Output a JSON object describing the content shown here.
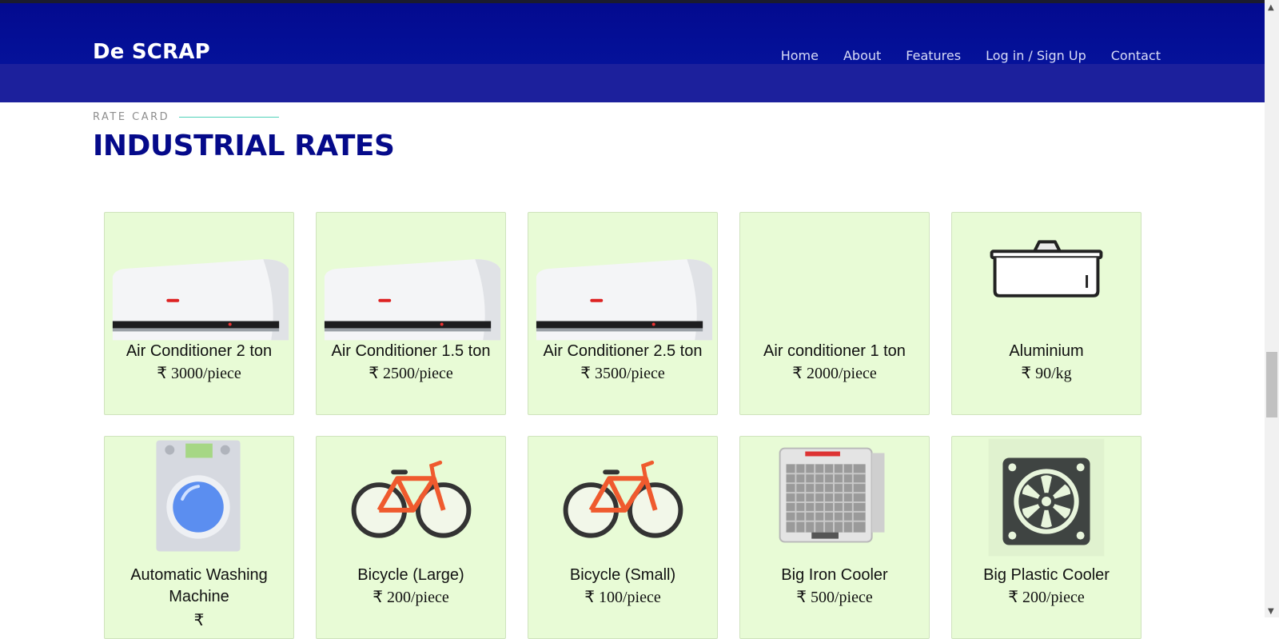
{
  "brand": "De SCRAP",
  "nav": [
    "Home",
    "About",
    "Features",
    "Log in / Sign Up",
    "Contact"
  ],
  "section": {
    "eyebrow": "RATE CARD",
    "title": "INDUSTRIAL RATES"
  },
  "currency_symbol": "₹",
  "colors": {
    "header": "#030a8f",
    "title": "#050a8a",
    "card_bg": "#e8fbd6",
    "accent_line": "#4fd1b8"
  },
  "items": [
    {
      "name": "Air Conditioner 2 ton",
      "price": "3000/piece",
      "icon": "air-conditioner"
    },
    {
      "name": "Air Conditioner 1.5 ton",
      "price": "2500/piece",
      "icon": "air-conditioner"
    },
    {
      "name": "Air Conditioner 2.5 ton",
      "price": "3500/piece",
      "icon": "air-conditioner"
    },
    {
      "name": "Air conditioner 1 ton",
      "price": "2000/piece",
      "icon": "none"
    },
    {
      "name": "Aluminium",
      "price": "90/kg",
      "icon": "aluminium-tray"
    },
    {
      "name": "Automatic Washing Machine",
      "price": "",
      "icon": "washing-machine"
    },
    {
      "name": "Bicycle (Large)",
      "price": "200/piece",
      "icon": "bicycle"
    },
    {
      "name": "Bicycle (Small)",
      "price": "100/piece",
      "icon": "bicycle"
    },
    {
      "name": "Big Iron Cooler",
      "price": "500/piece",
      "icon": "iron-cooler"
    },
    {
      "name": "Big Plastic Cooler",
      "price": "200/piece",
      "icon": "plastic-cooler"
    }
  ]
}
